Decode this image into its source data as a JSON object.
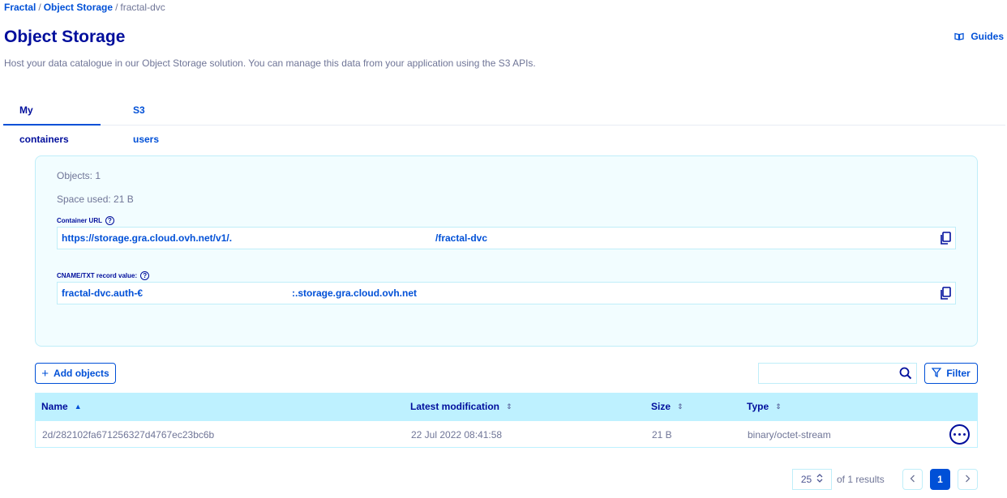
{
  "breadcrumb": {
    "root": "Fractal",
    "section": "Object Storage",
    "current": "fractal-dvc",
    "separator": "/"
  },
  "header": {
    "title": "Object Storage",
    "guides_label": "Guides",
    "subtitle": "Host your data catalogue in our Object Storage solution. You can manage this data from your application using the S3 APIs."
  },
  "tabs": [
    {
      "label": "My containers",
      "active": true
    },
    {
      "label": "S3 users",
      "active": false
    }
  ],
  "container": {
    "objects": "Objects: 1",
    "space_used": "Space used: 21 B",
    "url_label": "Container URL",
    "url_value_start": "https://storage.gra.cloud.ovh.net/v1/.",
    "url_value_end": "/fractal-dvc",
    "cname_label": "CNAME/TXT record value:",
    "cname_value_start": "fractal-dvc.auth-€",
    "cname_value_end": ":.storage.gra.cloud.ovh.net"
  },
  "toolbar": {
    "add_label": "Add objects",
    "search_placeholder": "",
    "filter_label": "Filter"
  },
  "table": {
    "columns": [
      "Name",
      "Latest modification",
      "Size",
      "Type"
    ],
    "rows": [
      {
        "name": "2d/282102fa671256327d4767ec23bc6b",
        "modified": "22 Jul 2022 08:41:58",
        "size": "21 B",
        "type": "binary/octet-stream"
      }
    ]
  },
  "pagination": {
    "page_size": "25",
    "results_text": "of 1 results",
    "current_page": "1"
  },
  "colors": {
    "primary": "#0050d7",
    "heading": "#000e9c",
    "header_bg": "#bef1ff",
    "panel_bg": "#f2fdff",
    "border": "#bfeef9"
  },
  "icons": [
    "book-icon",
    "help-icon",
    "copy-icon",
    "plus-icon",
    "search-icon",
    "filter-icon",
    "sort-icon",
    "more-icon",
    "chevron-left-icon",
    "chevron-right-icon",
    "updown-icon"
  ]
}
